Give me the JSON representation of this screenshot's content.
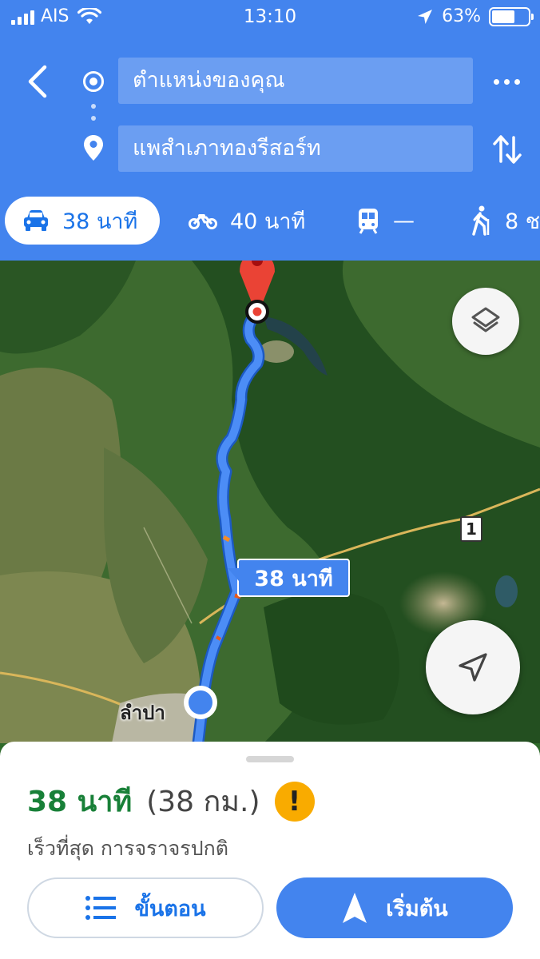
{
  "status_bar": {
    "carrier": "AIS",
    "time": "13:10",
    "battery": "63%",
    "battery_level": 0.63
  },
  "directions": {
    "origin": "ตำแหน่งของคุณ",
    "destination": "แพสำเภาทองรีสอร์ท"
  },
  "modes": [
    {
      "icon": "car-icon",
      "label": "38 นาที",
      "selected": true
    },
    {
      "icon": "motorcycle-icon",
      "label": "40 นาที",
      "selected": false
    },
    {
      "icon": "transit-icon",
      "label": "—",
      "selected": false
    },
    {
      "icon": "walk-icon",
      "label": "8 ช",
      "selected": false
    }
  ],
  "map": {
    "route_label": "38 นาที",
    "road_badge": "1",
    "city_label": "ลำปา"
  },
  "sheet": {
    "duration": "38 นาที",
    "distance": "(38 กม.)",
    "warning_symbol": "!",
    "subtitle": "เร็วที่สุด การจราจรปกติ",
    "steps_label": "ขั้นตอน",
    "start_label": "เริ่มต้น"
  },
  "colors": {
    "header_blue": "#4384ee",
    "route_blue": "#4c8df6",
    "duration_green": "#188038",
    "warning_yellow": "#f9ab00",
    "pin_red": "#ea4335"
  }
}
